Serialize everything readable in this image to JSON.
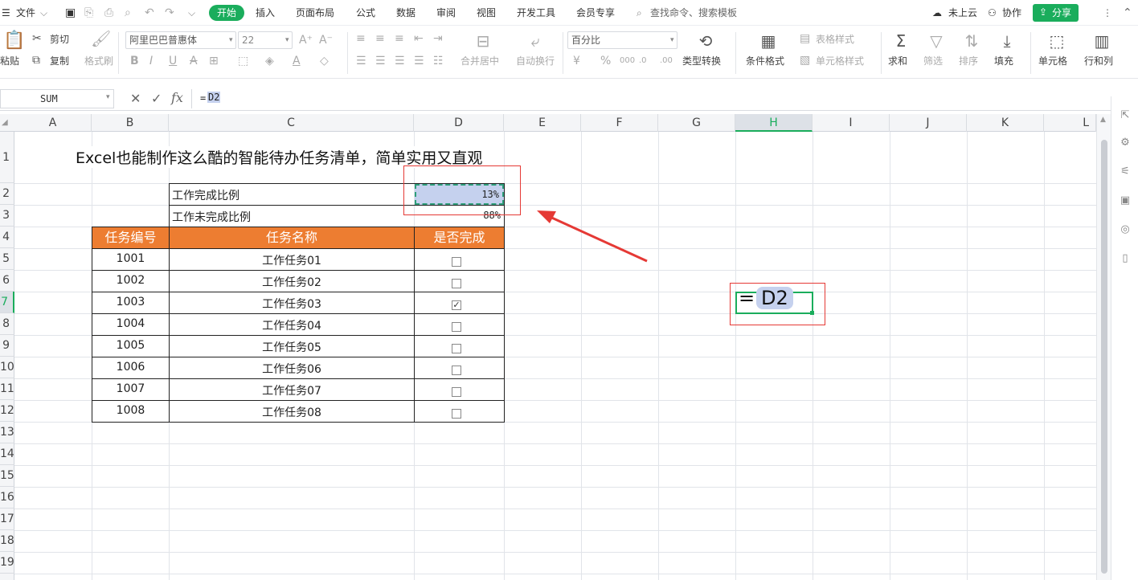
{
  "menubar": {
    "file_menu": "文件",
    "tabs": [
      "开始",
      "插入",
      "页面布局",
      "公式",
      "数据",
      "审阅",
      "视图",
      "开发工具",
      "会员专享"
    ],
    "active_tab": "开始",
    "search_placeholder": "查找命令、搜索模板",
    "cloud_status": "未上云",
    "collaborate": "协作",
    "share": "分享"
  },
  "ribbon": {
    "paste": "粘贴",
    "cut": "剪切",
    "copy": "复制",
    "format_painter": "格式刷",
    "font_name": "阿里巴巴普惠体",
    "font_size": "22",
    "merge_center": "合并居中",
    "auto_wrap": "自动换行",
    "number_format": "百分比",
    "type_convert": "类型转换",
    "conditional_format": "条件格式",
    "table_style": "表格样式",
    "cell_style": "单元格样式",
    "sum": "求和",
    "filter": "筛选",
    "sort": "排序",
    "fill": "填充",
    "cell": "单元格",
    "row_col": "行和列"
  },
  "formula_bar": {
    "name_box": "SUM",
    "formula_prefix": "=",
    "formula_ref": "D2"
  },
  "columns": [
    "A",
    "B",
    "C",
    "D",
    "E",
    "F",
    "G",
    "H",
    "I",
    "J",
    "K",
    "L"
  ],
  "selected_column": "H",
  "rows": [
    "1",
    "2",
    "3",
    "4",
    "5",
    "6",
    "7",
    "8",
    "9",
    "10",
    "11",
    "12",
    "13",
    "14",
    "15",
    "16",
    "17",
    "18",
    "19"
  ],
  "selected_row": "7",
  "sheet": {
    "title": "Excel也能制作这么酷的智能待办任务清单，简单实用又直观",
    "completed_label": "工作完成比例",
    "completed_value": "13%",
    "incomplete_label": "工作未完成比例",
    "incomplete_value": "88%",
    "table_headers": [
      "任务编号",
      "任务名称",
      "是否完成"
    ],
    "tasks": [
      {
        "id": "1001",
        "name": "工作任务01",
        "done": false
      },
      {
        "id": "1002",
        "name": "工作任务02",
        "done": false
      },
      {
        "id": "1003",
        "name": "工作任务03",
        "done": true
      },
      {
        "id": "1004",
        "name": "工作任务04",
        "done": false
      },
      {
        "id": "1005",
        "name": "工作任务05",
        "done": false
      },
      {
        "id": "1006",
        "name": "工作任务06",
        "done": false
      },
      {
        "id": "1007",
        "name": "工作任务07",
        "done": false
      },
      {
        "id": "1008",
        "name": "工作任务08",
        "done": false
      }
    ]
  },
  "edit_cell": {
    "prefix": "= ",
    "ref": "D2"
  },
  "colors": {
    "accent_green": "#1aad5c",
    "header_orange": "#ed7d31",
    "ref_highlight": "#c5d1ee",
    "annotation_red": "#e53935"
  }
}
